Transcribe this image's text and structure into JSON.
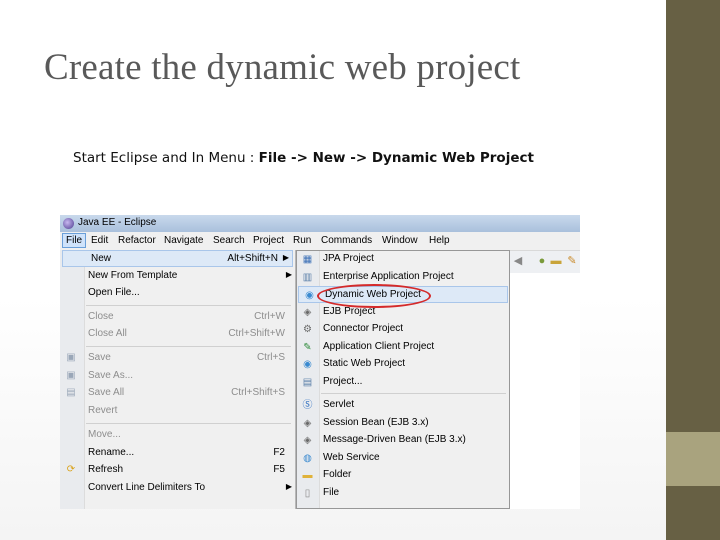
{
  "slide": {
    "title": "Create the dynamic web project",
    "subtitle_prefix": "Start Eclipse and In Menu : ",
    "subtitle_bold": "File -> New -> Dynamic Web Project",
    "colors": {
      "sidebar": "#676044",
      "sidebar_band": "#a9a37e",
      "title": "#595959"
    }
  },
  "window": {
    "title": "Java EE - Eclipse",
    "menubar": [
      "File",
      "Edit",
      "Refactor",
      "Navigate",
      "Search",
      "Project",
      "Run",
      "Commands",
      "Window",
      "Help"
    ],
    "active_menu": "File"
  },
  "file_menu": {
    "items": [
      {
        "label": "New",
        "shortcut": "Alt+Shift+N",
        "submenu": true,
        "enabled": true,
        "icon": ""
      },
      {
        "label": "New From Template",
        "shortcut": "",
        "submenu": true,
        "enabled": true,
        "icon": ""
      },
      {
        "label": "Open File...",
        "shortcut": "",
        "submenu": false,
        "enabled": true,
        "icon": ""
      },
      {
        "label": "Close",
        "shortcut": "Ctrl+W",
        "submenu": false,
        "enabled": false,
        "icon": ""
      },
      {
        "label": "Close All",
        "shortcut": "Ctrl+Shift+W",
        "submenu": false,
        "enabled": false,
        "icon": ""
      },
      {
        "label": "Save",
        "shortcut": "Ctrl+S",
        "submenu": false,
        "enabled": false,
        "icon": "save-icon"
      },
      {
        "label": "Save As...",
        "shortcut": "",
        "submenu": false,
        "enabled": false,
        "icon": "save-as-icon"
      },
      {
        "label": "Save All",
        "shortcut": "Ctrl+Shift+S",
        "submenu": false,
        "enabled": false,
        "icon": "save-all-icon"
      },
      {
        "label": "Revert",
        "shortcut": "",
        "submenu": false,
        "enabled": false,
        "icon": ""
      },
      {
        "label": "Move...",
        "shortcut": "",
        "submenu": false,
        "enabled": false,
        "icon": ""
      },
      {
        "label": "Rename...",
        "shortcut": "F2",
        "submenu": false,
        "enabled": true,
        "icon": ""
      },
      {
        "label": "Refresh",
        "shortcut": "F5",
        "submenu": false,
        "enabled": true,
        "icon": "refresh-icon"
      },
      {
        "label": "Convert Line Delimiters To",
        "shortcut": "",
        "submenu": true,
        "enabled": true,
        "icon": ""
      }
    ]
  },
  "new_submenu": {
    "items": [
      {
        "label": "JPA Project",
        "icon": "jpa-project-icon"
      },
      {
        "label": "Enterprise Application Project",
        "icon": "enterprise-app-icon"
      },
      {
        "label": "Dynamic Web Project",
        "icon": "web-project-icon"
      },
      {
        "label": "EJB Project",
        "icon": "ejb-project-icon"
      },
      {
        "label": "Connector Project",
        "icon": "connector-project-icon"
      },
      {
        "label": "Application Client Project",
        "icon": "app-client-icon"
      },
      {
        "label": "Static Web Project",
        "icon": "static-web-icon"
      },
      {
        "label": "Project...",
        "icon": "project-icon"
      },
      {
        "label": "Servlet",
        "icon": "servlet-icon"
      },
      {
        "label": "Session Bean (EJB 3.x)",
        "icon": "session-bean-icon"
      },
      {
        "label": "Message-Driven Bean (EJB 3.x)",
        "icon": "message-bean-icon"
      },
      {
        "label": "Web Service",
        "icon": "web-service-icon"
      },
      {
        "label": "Folder",
        "icon": "folder-icon"
      },
      {
        "label": "File",
        "icon": "file-icon"
      }
    ],
    "highlight_color": "#d42a2a"
  }
}
